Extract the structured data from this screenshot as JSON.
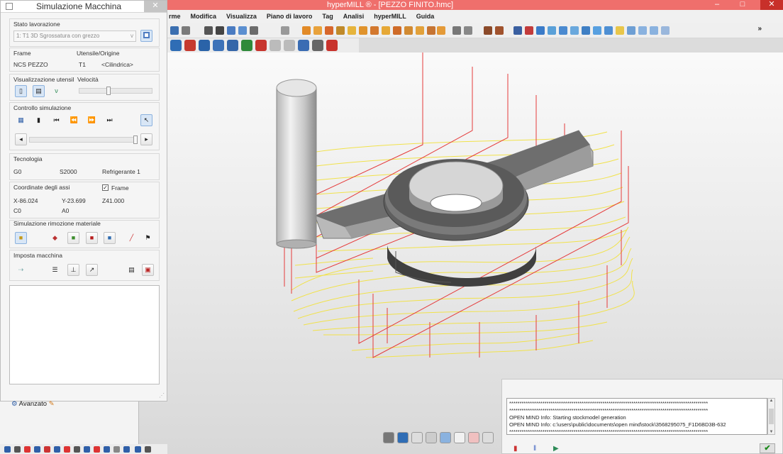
{
  "window": {
    "title": "hyperMILL ® - [PEZZO FINITO.hmc]",
    "minimize": "–",
    "maximize": "□",
    "close": "✕"
  },
  "menu": [
    "rme",
    "Modifica",
    "Visualizza",
    "Piano di lavoro",
    "Tag",
    "Analisi",
    "hyperMILL",
    "Guida"
  ],
  "toolbar_more": "»",
  "simulation": {
    "title": "Simulazione Macchina",
    "close": "✕",
    "stato_label": "Stato lavorazione",
    "stato_value": "1: T1 3D Sgrossatura con grezzo",
    "frame_label": "Frame",
    "frame_value": "NCS PEZZO",
    "utensile_label": "Utensile/Origine",
    "utensile_value": "T1",
    "origine_value": "<Cilindrica>",
    "vis_label": "Visualizzazione utensil",
    "velocita_label": "Velocità",
    "velocita_level": 0.4,
    "controllo_label": "Controllo simulazione",
    "tecnologia_label": "Tecnologia",
    "tec_g": "G0",
    "tec_s": "S2000",
    "tec_refrig": "Refrigerante 1",
    "coord_label": "Coordinate degli assi",
    "frame_check_label": "Frame",
    "frame_checked": "✓",
    "x": "X-86.024",
    "y": "Y-23.699",
    "z": "Z41.000",
    "c": "C0",
    "a": "A0",
    "rimozione_label": "Simulazione rimozione materiale",
    "imposta_label": "Imposta macchina"
  },
  "avanzato": "Avanzato",
  "console": {
    "lines": [
      "************************************************************************************************",
      "************************************************************************************************",
      "OPEN MIND Info:     Starting stockmodel generation",
      "OPEN MIND Info:     c:\\users\\public\\documents\\open mind\\stock\\3568295075_F1D6BD3B-632",
      "************************************************************************************************"
    ],
    "ok": "✔"
  },
  "colors": {
    "titlebar": "#ef6f6c",
    "toolpath_red": "#e53b3b",
    "toolpath_yellow": "#f1e24a",
    "accent": "#8cb2de"
  }
}
